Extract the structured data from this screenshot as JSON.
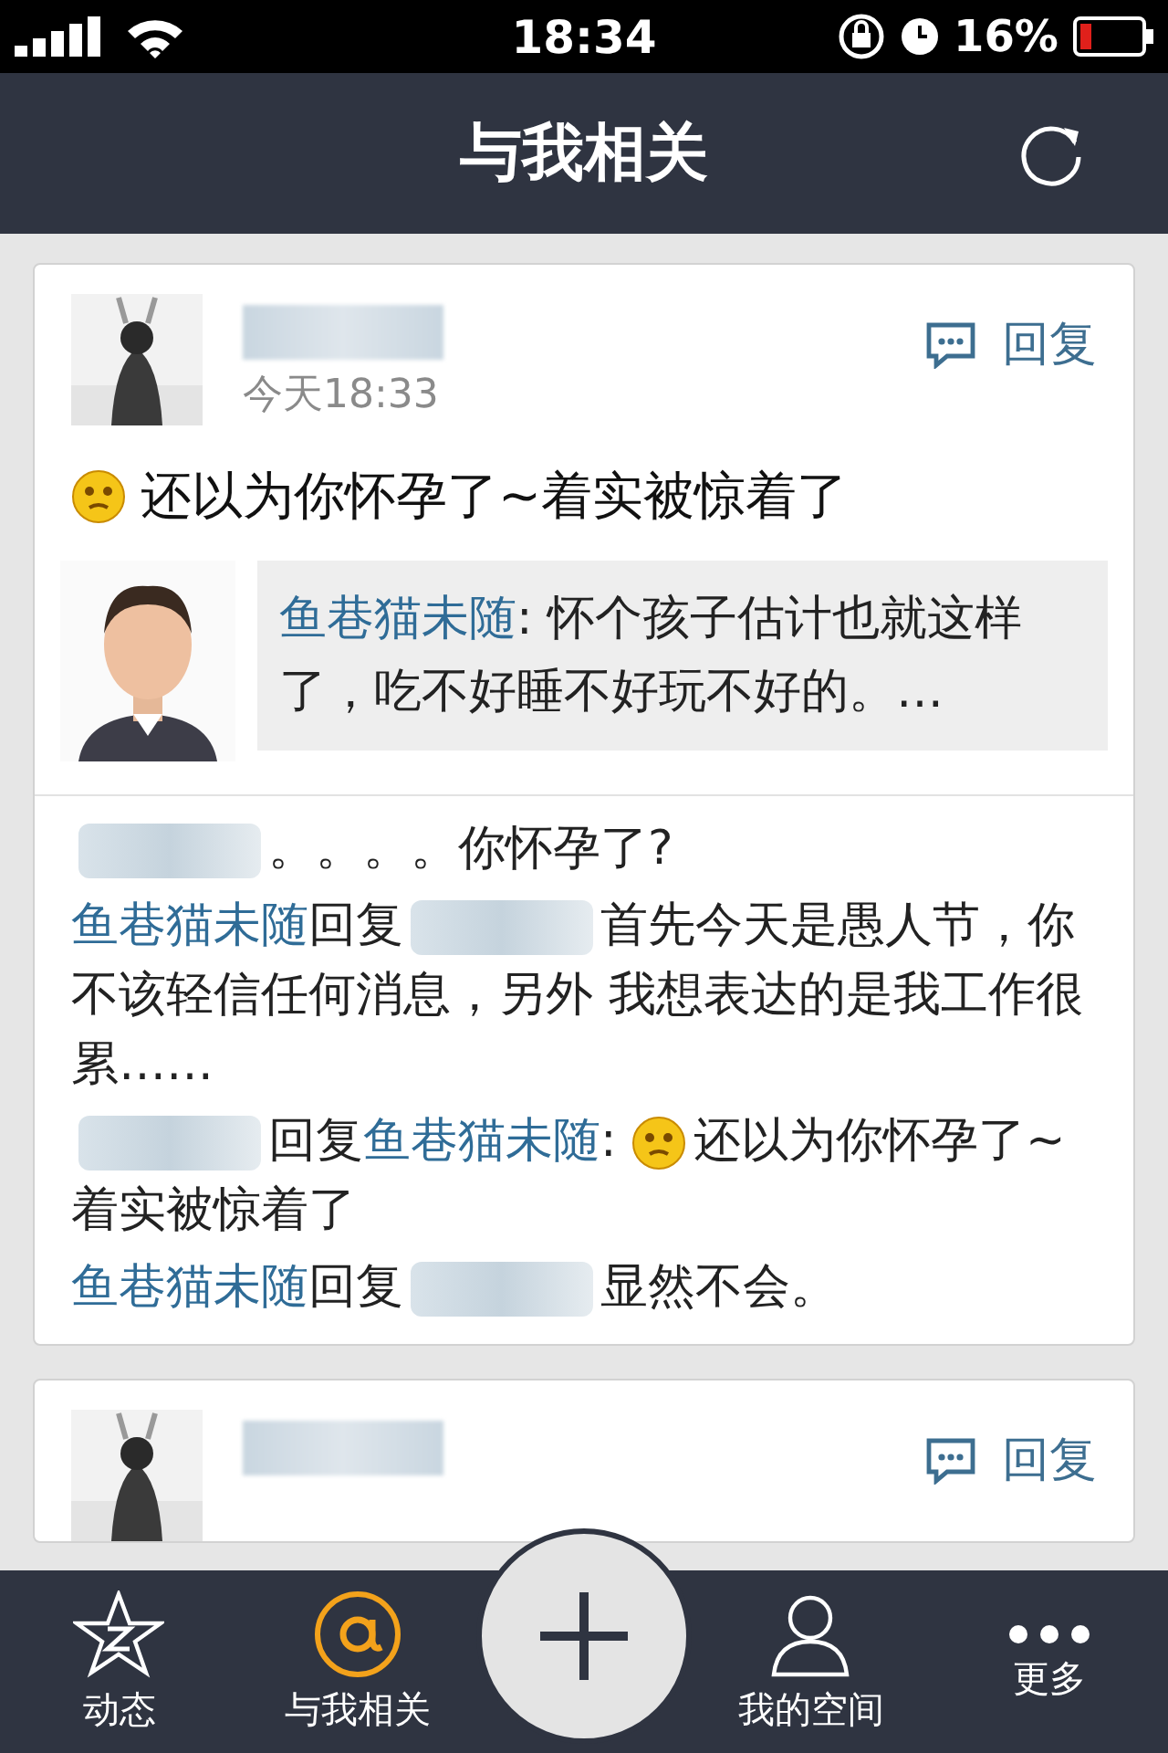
{
  "status_bar": {
    "time": "18:34",
    "battery": "16%"
  },
  "header": {
    "title": "与我相关"
  },
  "posts": [
    {
      "time": "今天18:33",
      "reply": "回复",
      "text": [
        {
          "kind": "emoji"
        },
        {
          "kind": "text",
          "text": "还以为你怀孕了~着实被惊着了"
        }
      ],
      "quote": {
        "author": "鱼巷猫未随",
        "text": ": 怀个孩子估计也就这样了，吃不好睡不好玩不好的。…"
      },
      "comments": [
        {
          "parts": [
            {
              "kind": "blur"
            },
            {
              "kind": "text",
              "text": "。。。。你怀孕了?"
            }
          ]
        },
        {
          "parts": [
            {
              "kind": "link",
              "text": "鱼巷猫未随"
            },
            {
              "kind": "text",
              "text": "回复"
            },
            {
              "kind": "blur"
            },
            {
              "kind": "text",
              "text": "首先今天是愚人节，你不该轻信任何消息，另外 我想表达的是我工作很累……"
            }
          ]
        },
        {
          "parts": [
            {
              "kind": "blur"
            },
            {
              "kind": "text",
              "text": "回复"
            },
            {
              "kind": "link",
              "text": "鱼巷猫未随"
            },
            {
              "kind": "text",
              "text": ": "
            },
            {
              "kind": "emoji"
            },
            {
              "kind": "text",
              "text": "还以为你怀孕了~着实被惊着了"
            }
          ]
        },
        {
          "parts": [
            {
              "kind": "link",
              "text": "鱼巷猫未随"
            },
            {
              "kind": "text",
              "text": "回复"
            },
            {
              "kind": "blur"
            },
            {
              "kind": "text",
              "text": "显然不会。"
            }
          ]
        }
      ]
    },
    {
      "reply": "回复"
    }
  ],
  "tabs": [
    {
      "kind": "star",
      "label": "动态",
      "selected": false
    },
    {
      "kind": "at",
      "label": "与我相关",
      "selected": true
    },
    {
      "kind": "plus",
      "selected": false
    },
    {
      "kind": "person",
      "label": "我的空间",
      "selected": false
    },
    {
      "kind": "more",
      "label": "更多",
      "selected": false
    }
  ]
}
